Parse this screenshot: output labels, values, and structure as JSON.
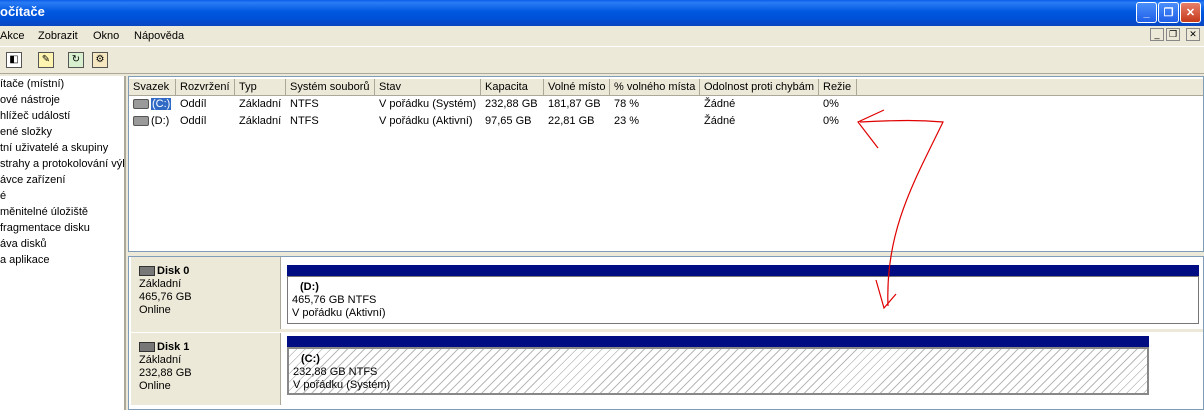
{
  "window": {
    "title": "očítače"
  },
  "window_buttons": {
    "min": "_",
    "max": "❐",
    "close": "✕"
  },
  "menu": [
    "Akce",
    "Zobrazit",
    "Okno",
    "Nápověda"
  ],
  "mdi_buttons": {
    "min": "_",
    "restore": "❐",
    "close": "✕"
  },
  "toolbar_icons": [
    "tree-toggle-icon",
    "properties-icon",
    "refresh-icon",
    "settings-icon"
  ],
  "tree": [
    "ítače (místní)",
    "ové nástroje",
    "hlížeč událostí",
    "ené složky",
    "tní uživatelé a skupiny",
    "strahy a protokolování výk",
    "ávce zařízení",
    "é",
    "měnitelné úložiště",
    "fragmentace disku",
    "áva disků",
    "a aplikace"
  ],
  "volume_table": {
    "columns": [
      "Svazek",
      "Rozvržení",
      "Typ",
      "Systém souborů",
      "Stav",
      "Kapacita",
      "Volné místo",
      "% volného místa",
      "Odolnost proti chybám",
      "Režie"
    ],
    "rows": [
      [
        "(C:)",
        "Oddíl",
        "Základní",
        "NTFS",
        "V pořádku (Systém)",
        "232,88 GB",
        "181,87 GB",
        "78 %",
        "Žádné",
        "0%"
      ],
      [
        "(D:)",
        "Oddíl",
        "Základní",
        "NTFS",
        "V pořádku (Aktivní)",
        "97,65 GB",
        "22,81 GB",
        "23 %",
        "Žádné",
        "0%"
      ]
    ]
  },
  "disks": [
    {
      "name": "Disk 0",
      "type": "Základní",
      "size": "465,76 GB",
      "status": "Online",
      "volume": {
        "label": "(D:)",
        "size_fs": "465,76 GB NTFS",
        "status": "V pořádku (Aktivní)"
      }
    },
    {
      "name": "Disk 1",
      "type": "Základní",
      "size": "232,88 GB",
      "status": "Online",
      "volume": {
        "label": "(C:)",
        "size_fs": "232,88 GB NTFS",
        "status": "V pořádku (Systém)"
      }
    }
  ],
  "colors": {
    "title_bar": "#0054E3",
    "volume_bar": "#000C82",
    "annotation": "#E00000"
  }
}
